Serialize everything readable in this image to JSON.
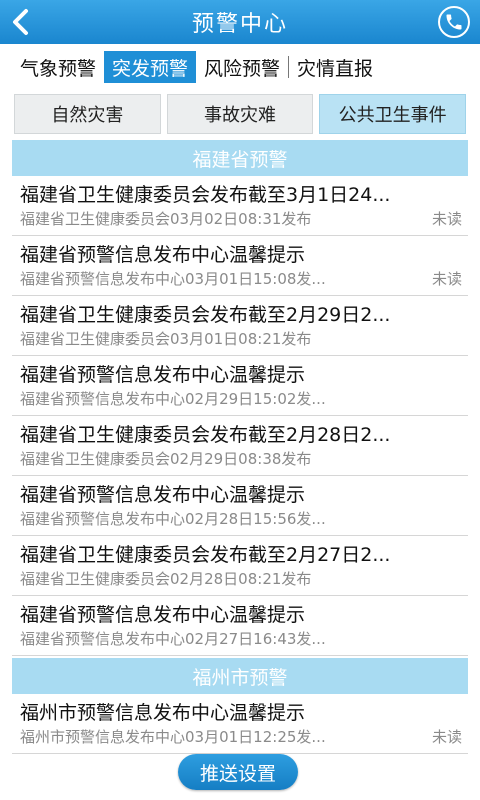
{
  "header": {
    "title": "预警中心",
    "back_icon": "back-chevron-icon",
    "phone_icon": "phone-icon"
  },
  "tabs": [
    {
      "label": "气象预警",
      "active": false
    },
    {
      "label": "突发预警",
      "active": true
    },
    {
      "label": "风险预警",
      "active": false
    },
    {
      "label": "灾情直报",
      "active": false
    }
  ],
  "subtabs": [
    {
      "label": "自然灾害",
      "active": false
    },
    {
      "label": "事故灾难",
      "active": false
    },
    {
      "label": "公共卫生事件",
      "active": true
    }
  ],
  "sections": [
    {
      "title": "福建省预警",
      "items": [
        {
          "title": "福建省卫生健康委员会发布截至3月1日24...",
          "meta": "福建省卫生健康委员会03月02日08:31发布",
          "badge": "未读"
        },
        {
          "title": "福建省预警信息发布中心温馨提示",
          "meta": "福建省预警信息发布中心03月01日15:08发...",
          "badge": "未读"
        },
        {
          "title": "福建省卫生健康委员会发布截至2月29日2...",
          "meta": "福建省卫生健康委员会03月01日08:21发布",
          "badge": ""
        },
        {
          "title": "福建省预警信息发布中心温馨提示",
          "meta": "福建省预警信息发布中心02月29日15:02发...",
          "badge": ""
        },
        {
          "title": "福建省卫生健康委员会发布截至2月28日2...",
          "meta": "福建省卫生健康委员会02月29日08:38发布",
          "badge": ""
        },
        {
          "title": "福建省预警信息发布中心温馨提示",
          "meta": "福建省预警信息发布中心02月28日15:56发...",
          "badge": ""
        },
        {
          "title": "福建省卫生健康委员会发布截至2月27日2...",
          "meta": "福建省卫生健康委员会02月28日08:21发布",
          "badge": ""
        },
        {
          "title": "福建省预警信息发布中心温馨提示",
          "meta": "福建省预警信息发布中心02月27日16:43发...",
          "badge": ""
        }
      ]
    },
    {
      "title": "福州市预警",
      "items": [
        {
          "title": "福州市预警信息发布中心温馨提示",
          "meta": "福州市预警信息发布中心03月01日12:25发...",
          "badge": "未读"
        }
      ]
    }
  ],
  "bottom_button": {
    "label": "推送设置"
  },
  "colors": {
    "primary": "#1f8fd6",
    "section_header": "#a8dbf2",
    "subtab_active": "#b9e2f4"
  }
}
